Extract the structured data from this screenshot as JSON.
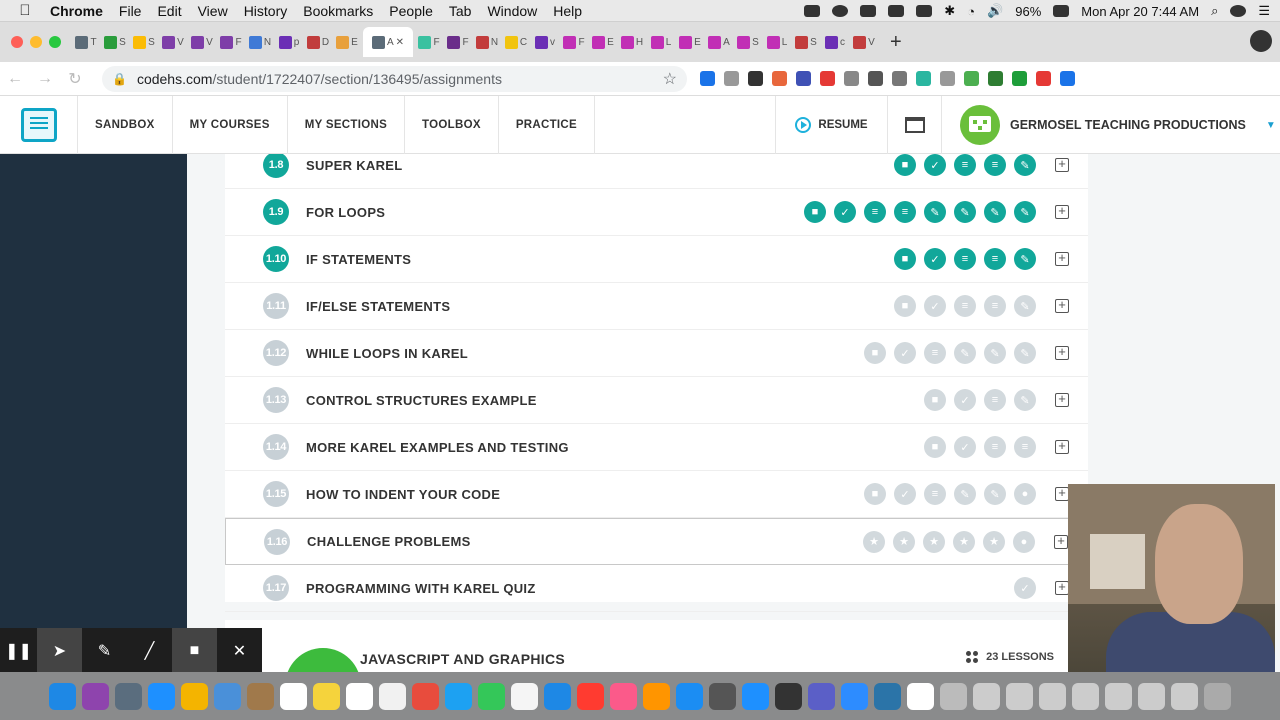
{
  "menubar": {
    "app": "Chrome",
    "items": [
      "File",
      "Edit",
      "View",
      "History",
      "Bookmarks",
      "People",
      "Tab",
      "Window",
      "Help"
    ],
    "battery": "96%",
    "clock": "Mon Apr 20  7:44 AM"
  },
  "browser": {
    "tab_icon_colors": [
      "#5b6b78",
      "#2a9d3c",
      "#fbbc05",
      "#7e3ea8",
      "#7e3ea8",
      "#7e3ea8",
      "#3f7ad6",
      "#6b2fb5",
      "#c13c3c",
      "#e8a03c",
      "#5b6b78",
      "#3ac1a0",
      "#6a2d8a",
      "#c23c3c",
      "#f1c40f",
      "#6b2fb5",
      "#c12fb5",
      "#c12fb5",
      "#c12fb5",
      "#c12fb5",
      "#c12fb5",
      "#c12fb5",
      "#c12fb5",
      "#c12fb5",
      "#c23c3c",
      "#6b2fb5",
      "#c23c3c"
    ],
    "tab_letters": [
      "T",
      "S",
      "S",
      "V",
      "V",
      "F",
      "N",
      "p",
      "D",
      "E",
      "A",
      "F",
      "F",
      "N",
      "C",
      "v",
      "F",
      "E",
      "H",
      "L",
      "E",
      "A",
      "S",
      "L",
      "S",
      "c",
      "V"
    ],
    "url_domain": "codehs.com",
    "url_path": "/student/1722407/section/136495/assignments",
    "ext_colors": [
      "#1a73e8",
      "#999",
      "#333",
      "#e8673c",
      "#3f51b5",
      "#e53935",
      "#888",
      "#555",
      "#777",
      "#2ab6a0",
      "#999",
      "#4caf50",
      "#2e7d32",
      "#1e9e3a",
      "#e53935",
      "#1a73e8"
    ]
  },
  "site_nav": {
    "items": [
      "SANDBOX",
      "MY COURSES",
      "MY SECTIONS",
      "TOOLBOX",
      "PRACTICE"
    ],
    "resume": "RESUME",
    "user": "GERMOSEL TEACHING PRODUCTIONS"
  },
  "lessons": [
    {
      "num": "1.8",
      "title": "SUPER KAREL",
      "active": true,
      "acts": [
        "video",
        "check",
        "doc",
        "doc",
        "edit"
      ]
    },
    {
      "num": "1.9",
      "title": "FOR LOOPS",
      "active": true,
      "acts": [
        "video",
        "check",
        "doc",
        "doc",
        "edit",
        "edit",
        "edit",
        "edit"
      ]
    },
    {
      "num": "1.10",
      "title": "IF STATEMENTS",
      "active": true,
      "acts": [
        "video",
        "check",
        "doc",
        "doc",
        "edit"
      ]
    },
    {
      "num": "1.11",
      "title": "IF/ELSE STATEMENTS",
      "active": false,
      "acts": [
        "video",
        "check",
        "doc",
        "doc",
        "edit"
      ]
    },
    {
      "num": "1.12",
      "title": "WHILE LOOPS IN KAREL",
      "active": false,
      "acts": [
        "video",
        "check",
        "doc",
        "edit",
        "edit",
        "edit"
      ]
    },
    {
      "num": "1.13",
      "title": "CONTROL STRUCTURES EXAMPLE",
      "active": false,
      "acts": [
        "video",
        "check",
        "doc",
        "edit"
      ]
    },
    {
      "num": "1.14",
      "title": "MORE KAREL EXAMPLES AND TESTING",
      "active": false,
      "acts": [
        "video",
        "check",
        "doc",
        "doc"
      ]
    },
    {
      "num": "1.15",
      "title": "HOW TO INDENT YOUR CODE",
      "active": false,
      "acts": [
        "video",
        "check",
        "doc",
        "edit",
        "edit",
        "circle"
      ]
    },
    {
      "num": "1.16",
      "title": "CHALLENGE PROBLEMS",
      "active": false,
      "highlighted": true,
      "acts": [
        "star",
        "star",
        "star",
        "star",
        "star",
        "circle"
      ]
    },
    {
      "num": "1.17",
      "title": "PROGRAMMING WITH KAREL QUIZ",
      "active": false,
      "acts": [
        "check"
      ]
    }
  ],
  "next_unit": {
    "title": "JAVASCRIPT AND GRAPHICS",
    "lessons": "23 LESSONS"
  },
  "dock_icon_colors": [
    "#1e88e5",
    "#8e44ad",
    "#5a6d7e",
    "#1e90ff",
    "#f4b400",
    "#4a90d9",
    "#a0794b",
    "#fff",
    "#f5d33c",
    "#fff",
    "#f1f1f1",
    "#e84c3d",
    "#1da1f2",
    "#34c759",
    "#f5f5f5",
    "#1e88e5",
    "#ff3b30",
    "#fb5a8a",
    "#ff9500",
    "#1b8df3",
    "#555",
    "#1e90ff",
    "#333",
    "#5b5fc7",
    "#2d8cff",
    "#2b74a8",
    "#fff",
    "#bbb",
    "#ccc",
    "#ccc",
    "#ccc",
    "#ccc",
    "#ccc",
    "#ccc",
    "#ccc",
    "#aaa"
  ]
}
